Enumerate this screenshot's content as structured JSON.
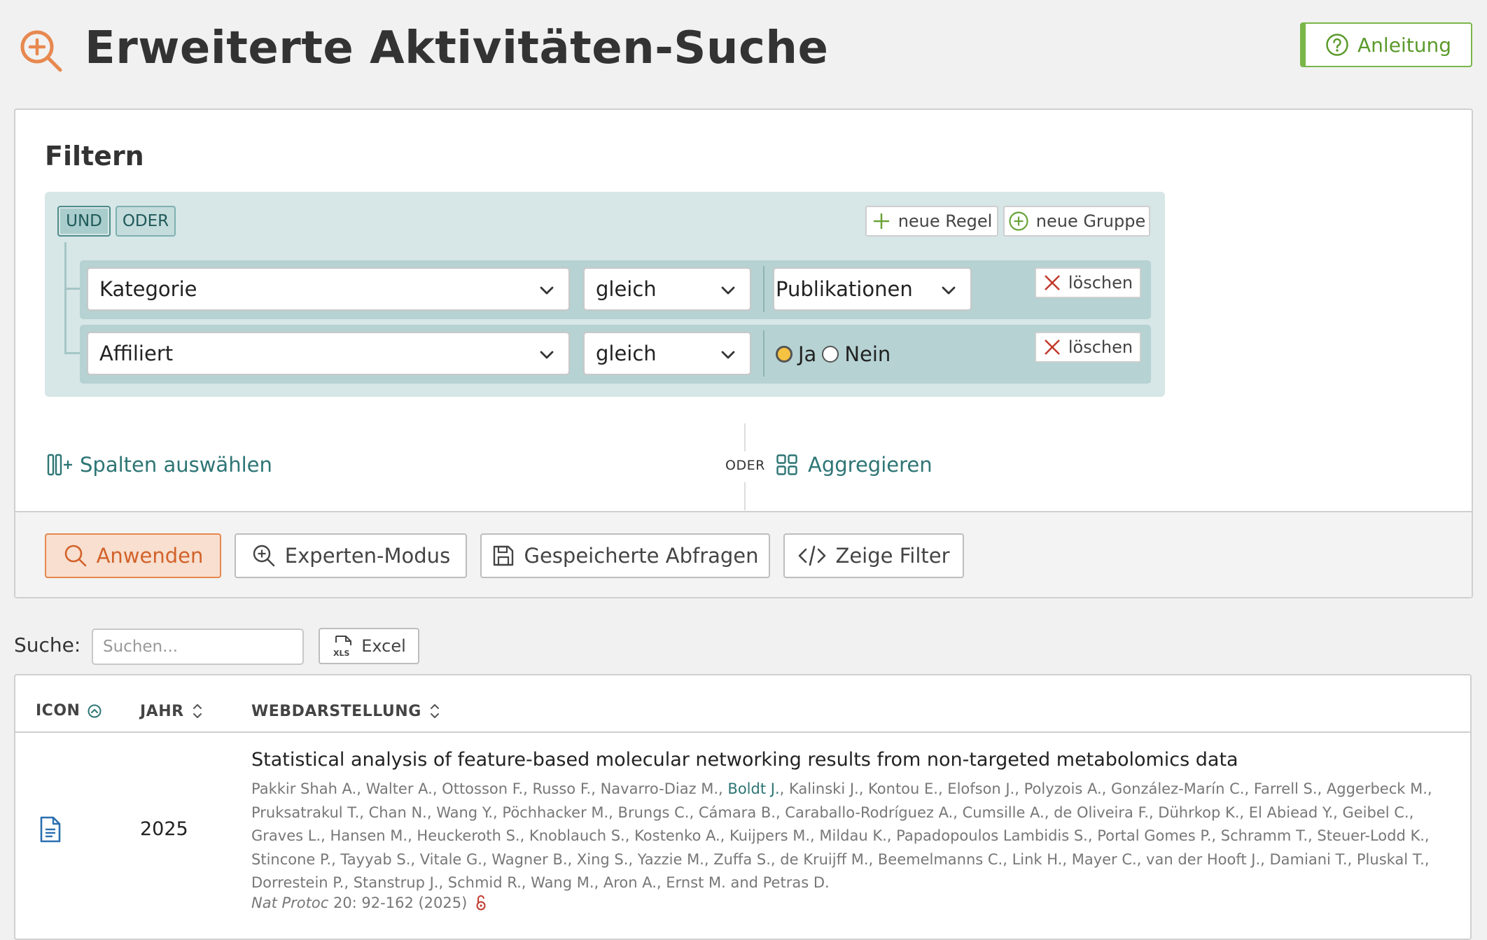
{
  "header": {
    "title": "Erweiterte Aktivitäten-Suche",
    "help_label": "Anleitung"
  },
  "filter": {
    "heading": "Filtern",
    "combinators": {
      "and": "UND",
      "or": "ODER",
      "active": "UND"
    },
    "add_rule_label": "neue Regel",
    "add_group_label": "neue Gruppe",
    "delete_label": "löschen",
    "rules": [
      {
        "field": "Kategorie",
        "operator": "gleich",
        "value": "Publikationen"
      },
      {
        "field": "Affiliert",
        "operator": "gleich",
        "options": [
          "Ja",
          "Nein"
        ],
        "selected": "Ja"
      }
    ],
    "columns_label": "Spalten auswählen",
    "or_label": "ODER",
    "aggregate_label": "Aggregieren"
  },
  "actions": {
    "apply": "Anwenden",
    "expert": "Experten-Modus",
    "saved": "Gespeicherte Abfragen",
    "show_filter": "Zeige Filter"
  },
  "search": {
    "label": "Suche:",
    "placeholder": "Suchen...",
    "value": "",
    "excel_label": "Excel"
  },
  "table": {
    "columns": [
      "ICON",
      "JAHR",
      "WEBDARSTELLUNG"
    ],
    "rows": [
      {
        "icon": "document-icon",
        "year": "2025",
        "title": "Statistical analysis of feature-based molecular networking results from non-targeted metabolomics data",
        "authors_before": "Pakkir Shah A., Walter A., Ottosson F., Russo F., Navarro-Diaz M., ",
        "authors_highlight": "Boldt J.",
        "authors_after": ", Kalinski J., Kontou E., Elofson J., Polyzois A., González-Marín C., Farrell S., Aggerbeck M., Pruksatrakul T., Chan N., Wang Y., Pöchhacker M., Brungs C., Cámara B., Caraballo-Rodríguez A., Cumsille A., de Oliveira F., Dührkop K., El Abiead Y., Geibel C., Graves L., Hansen M., Heuckeroth S., Knoblauch S., Kostenko A., Kuijpers M., Mildau K., Papadopoulos Lambidis S., Portal Gomes P., Schramm T., Steuer-Lodd K., Stincone P., Tayyab S., Vitale G., Wagner B., Xing S., Yazzie M., Zuffa S., de Kruijff M., Beemelmanns C., Link H., Mayer C., van der Hooft J., Damiani T., Pluskal T., Dorrestein P., Stanstrup J., Schmid R., Wang M., Aron A., Ernst M. and Petras D.",
        "journal": "Nat Protoc",
        "citation_rest": "20: 92-162 (2025)"
      }
    ]
  },
  "colors": {
    "accent_orange": "#e7884f",
    "teal": "#2e7575",
    "green": "#7ab648",
    "delete_red": "#c0392b"
  }
}
